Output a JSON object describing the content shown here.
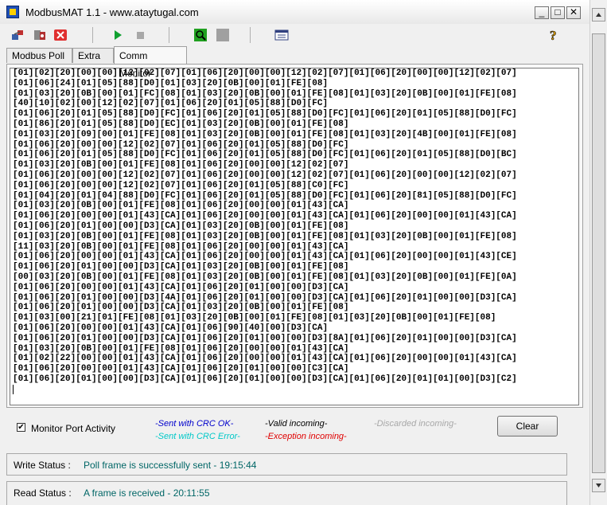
{
  "window": {
    "title": "ModbusMAT 1.1  -  www.ataytugal.com",
    "minimize": "_",
    "maximize": "□",
    "close": "✕"
  },
  "tabs": [
    {
      "label": "Modbus Poll"
    },
    {
      "label": "Extra"
    },
    {
      "label": "Comm Monitor"
    }
  ],
  "monitor": {
    "lines": [
      "[01][02][20][00][00][12][02][07][01][06][20][00][00][12][02][07][01][06][20][00][00][12][02][07]",
      "[01][06][24][01][05][88][D0][01][03][20][0B][00][01][FE][08]",
      "[01][03][20][0B][00][01][FC][08][01][03][20][0B][00][01][FE][08][01][03][20][0B][00][01][FE][08]",
      "[40][10][02][00][12][02][07][01][06][20][01][05][88][D0][FC]",
      "[01][06][20][01][05][88][D0][FC][01][06][20][01][05][88][D0][FC][01][06][20][01][05][88][D0][FC]",
      "[01][86][20][01][05][88][D0][EC][01][03][20][0B][00][01][FE][08]",
      "[01][03][20][09][00][01][FE][08][01][03][20][0B][00][01][FE][08][01][03][20][4B][00][01][FE][08]",
      "[01][06][20][00][00][12][02][07][01][06][20][01][05][88][D0][FC]",
      "[01][06][20][01][05][88][D0][FC][01][06][20][01][05][88][D0][FC][01][06][20][01][05][88][D0][BC]",
      "[01][03][20][0B][00][01][FE][08][01][06][20][00][00][12][02][07]",
      "[01][06][20][00][00][12][02][07][01][06][20][00][00][12][02][07][01][06][20][00][00][12][02][07]",
      "[01][06][20][00][00][12][02][07][01][06][20][01][05][88][C0][FC]",
      "[01][04][20][01][04][88][D0][FC][01][06][20][01][05][88][D0][FC][01][06][20][81][05][88][D0][FC]",
      "[01][03][20][0B][00][01][FE][08][01][06][20][00][00][01][43][CA]",
      "[01][06][20][00][00][01][43][CA][01][06][20][00][00][01][43][CA][01][06][20][00][00][01][43][CA]",
      "[01][06][20][01][00][00][D3][CA][01][03][20][0B][00][01][FE][08]",
      "[01][03][20][0B][00][01][FE][08][01][03][20][0B][00][01][FE][08][01][03][20][0B][00][01][FE][08]",
      "[11][03][20][0B][00][01][FE][08][01][06][20][00][00][01][43][CA]",
      "[01][06][20][00][00][01][43][CA][01][06][20][00][00][01][43][CA][01][06][20][00][00][01][43][CE]",
      "[01][06][20][01][00][00][D3][CA][01][03][20][0B][00][01][FE][08]",
      "[00][03][20][0B][00][01][FE][08][01][03][20][0B][00][01][FE][08][01][03][20][0B][00][01][FE][0A]",
      "[01][06][20][00][00][01][43][CA][01][06][20][01][00][00][D3][CA]",
      "[01][06][20][01][00][00][D3][4A][01][06][20][01][00][00][D3][CA][01][06][20][01][00][00][D3][CA]",
      "[01][06][20][01][00][00][D3][CA][01][03][20][0B][00][01][FE][08]",
      "[01][03][00][21][01][FE][08][01][03][20][0B][00][01][FE][08][01][03][20][0B][00][01][FE][08]",
      "[01][06][20][00][00][01][43][CA][01][06][90][40][00][D3][CA]",
      "[01][06][20][01][00][00][D3][CA][01][06][20][01][00][00][D3][8A][01][06][20][01][00][00][D3][CA]",
      "[01][03][20][0B][00][01][FE][08][01][06][20][00][00][01][43][CA]",
      "[01][02][22][00][00][01][43][CA][01][06][20][00][00][01][43][CA][01][06][20][00][00][01][43][CA]",
      "[01][06][20][00][00][01][43][CA][01][06][20][01][00][00][C3][CA]",
      "[01][06][20][01][00][00][D3][CA][01][06][20][01][00][00][D3][CA][01][06][20][01][01][00][D3][C2]"
    ]
  },
  "controls": {
    "monitor_port_activity_label": "Monitor Port Activity",
    "monitor_port_activity_checked": true,
    "check_glyph": "✔",
    "clear_label": "Clear"
  },
  "legend": {
    "sent_ok": {
      "text": "-Sent with CRC OK-",
      "color": "#0000cc"
    },
    "sent_error": {
      "text": "-Sent with CRC Error-",
      "color": "#00c8c8"
    },
    "valid_incoming": {
      "text": "-Valid incoming-",
      "color": "#000000"
    },
    "discarded_incoming": {
      "text": "-Discarded incoming-",
      "color": "#a8a8a8"
    },
    "exception_incoming": {
      "text": "-Exception incoming-",
      "color": "#e00000"
    }
  },
  "status": {
    "write_label": "Write Status :",
    "write_value": "Poll frame is successfully sent  - 19:15:44",
    "read_label": "Read Status :",
    "read_value": "A frame is received  - 20:11:55"
  },
  "toolbar_icons": [
    "connect-icon",
    "settings-icon",
    "disconnect-icon",
    "play-icon",
    "stop-icon",
    "zoom-icon",
    "blank-icon",
    "list-icon",
    "help-icon"
  ],
  "colors": {
    "status_text": "#006666"
  }
}
